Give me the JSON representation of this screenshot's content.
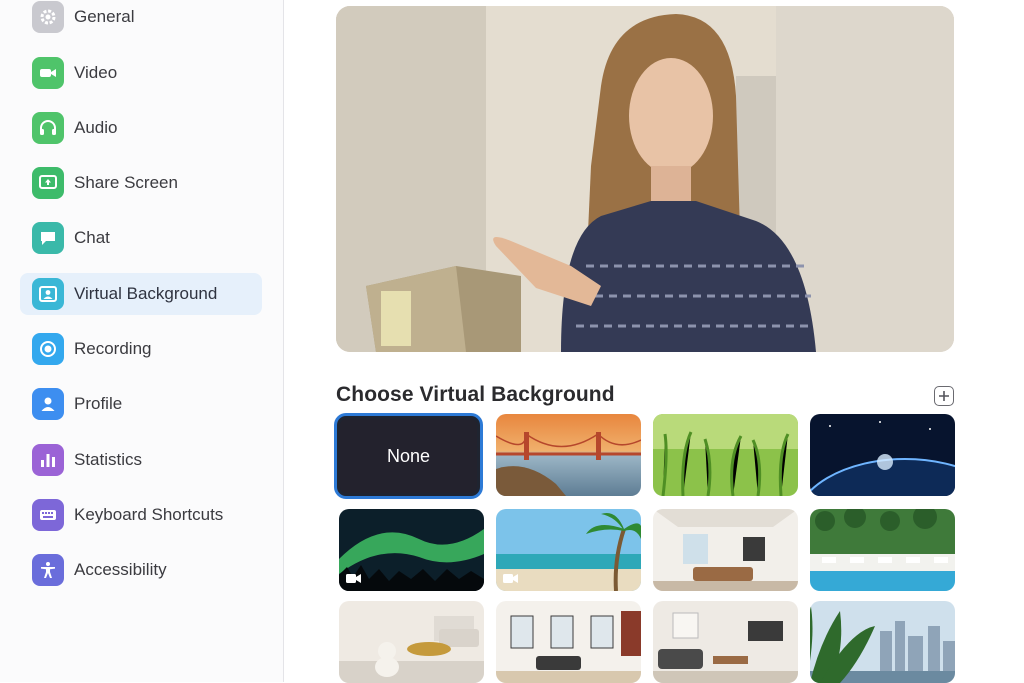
{
  "sidebar": {
    "items": [
      {
        "label": "General",
        "icon": "gear-icon",
        "color": "#c9c9cf",
        "selected": false
      },
      {
        "label": "Video",
        "icon": "video-camera-icon",
        "color": "#4fc46a",
        "selected": false
      },
      {
        "label": "Audio",
        "icon": "headphones-icon",
        "color": "#4fc46a",
        "selected": false
      },
      {
        "label": "Share Screen",
        "icon": "share-screen-icon",
        "color": "#3dbb6a",
        "selected": false
      },
      {
        "label": "Chat",
        "icon": "chat-bubble-icon",
        "color": "#3ab9a9",
        "selected": false
      },
      {
        "label": "Virtual Background",
        "icon": "person-background-icon",
        "color": "#3ab7d6",
        "selected": true
      },
      {
        "label": "Recording",
        "icon": "record-icon",
        "color": "#33a8ee",
        "selected": false
      },
      {
        "label": "Profile",
        "icon": "profile-icon",
        "color": "#3d8ef0",
        "selected": false
      },
      {
        "label": "Statistics",
        "icon": "bar-chart-icon",
        "color": "#9b63d6",
        "selected": false
      },
      {
        "label": "Keyboard Shortcuts",
        "icon": "keyboard-icon",
        "color": "#7d67d8",
        "selected": false
      },
      {
        "label": "Accessibility",
        "icon": "accessibility-icon",
        "color": "#6a6ddb",
        "selected": false
      }
    ]
  },
  "main": {
    "section_title": "Choose Virtual Background",
    "add_icon": "plus-icon",
    "backgrounds": [
      {
        "label": "None",
        "selected": true
      },
      {
        "name": "golden-gate-bridge",
        "is_video": false
      },
      {
        "name": "grass",
        "is_video": false
      },
      {
        "name": "earth-from-space",
        "is_video": false
      },
      {
        "name": "northern-lights",
        "is_video": true
      },
      {
        "name": "beach-palm-tree",
        "is_video": true
      },
      {
        "name": "bright-living-room",
        "is_video": false
      },
      {
        "name": "pool-garden",
        "is_video": false
      },
      {
        "name": "living-room-dog",
        "is_video": false
      },
      {
        "name": "loft-interior",
        "is_video": false
      },
      {
        "name": "modern-lounge",
        "is_video": false
      },
      {
        "name": "city-view-plant",
        "is_video": false
      }
    ]
  },
  "colors": {
    "selected_nav_bg": "#e6f0fb",
    "selection_outline": "#2d7ad6"
  }
}
